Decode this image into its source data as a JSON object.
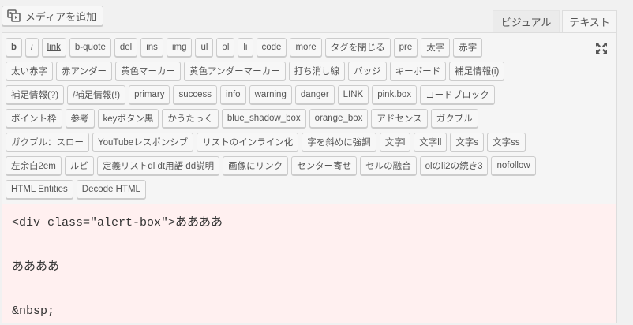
{
  "media_button": {
    "label": "メディアを追加"
  },
  "tabs": {
    "visual": "ビジュアル",
    "text": "テキスト"
  },
  "toolbar": {
    "rows": [
      [
        "b",
        "i",
        "link",
        "b-quote",
        "del",
        "ins",
        "img",
        "ul",
        "ol",
        "li",
        "code",
        "more",
        "タグを閉じる",
        "pre",
        "太字",
        "赤字"
      ],
      [
        "太い赤字",
        "赤アンダー",
        "黄色マーカー",
        "黄色アンダーマーカー",
        "打ち消し線",
        "バッジ",
        "キーボード",
        "補足情報(i)"
      ],
      [
        "補足情報(?)",
        "/補足情報(!)",
        "primary",
        "success",
        "info",
        "warning",
        "danger",
        "LINK",
        "pink.box",
        "コードブロック"
      ],
      [
        "ポイント枠",
        "参考",
        "keyボタン黒",
        "かうたっく",
        "blue_shadow_box",
        "orange_box",
        "アドセンス",
        "ガクブル"
      ],
      [
        "ガクブル：スロー",
        "YouTubeレスポンシブ",
        "リストのインライン化",
        "字を斜めに強調",
        "文字l",
        "文字ll",
        "文字s",
        "文字ss"
      ],
      [
        "左余白2em",
        "ルビ",
        "定義リストdl dt用語 dd説明",
        "画像にリンク",
        "センター寄せ",
        "セルの融合",
        "olのli2の続き3",
        "nofollow"
      ],
      [
        "HTML Entities",
        "Decode HTML"
      ]
    ]
  },
  "editor": {
    "lines": [
      "<div class=\"alert-box\">ああああ",
      "",
      "ああああ",
      "",
      "&nbsp;"
    ]
  }
}
